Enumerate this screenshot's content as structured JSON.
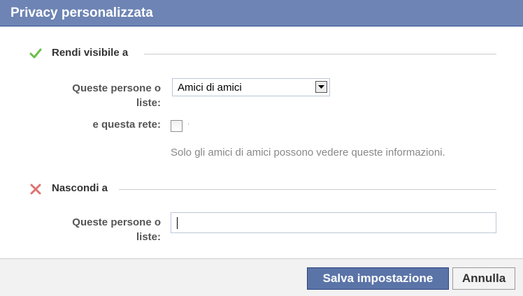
{
  "dialog": {
    "title": "Privacy personalizzata"
  },
  "visible_section": {
    "header": "Rendi visibile a",
    "icon": "check-icon",
    "icon_color": "#6bbf4a",
    "people_label": "Queste persone o liste:",
    "people_select_value": "Amici di amici",
    "network_label": "e questa rete:",
    "network_checked": false,
    "hint": "Solo gli amici di amici possono vedere queste informazioni."
  },
  "hidden_section": {
    "header": "Nascondi a",
    "icon": "cross-icon",
    "icon_color": "#e07272",
    "people_label": "Queste persone o liste:",
    "people_input_value": ""
  },
  "footer": {
    "save_label": "Salva impostazione",
    "cancel_label": "Annulla"
  },
  "colors": {
    "title_bar": "#6d84b4",
    "primary_button": "#5b74a8"
  }
}
